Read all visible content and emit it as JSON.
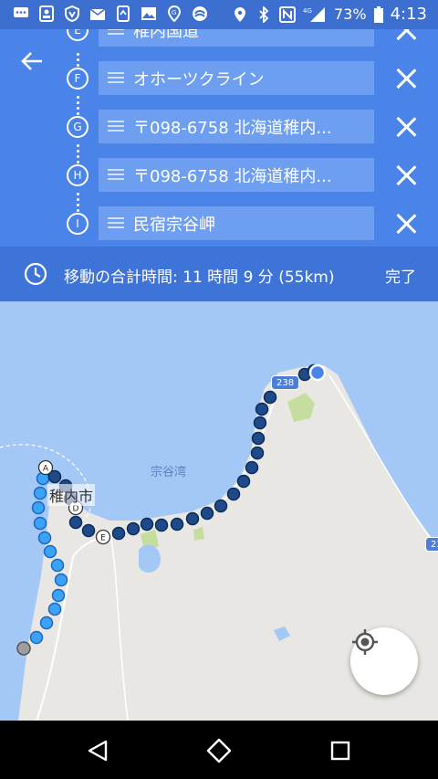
{
  "status_bar": {
    "network": "4G",
    "battery": "73%",
    "time": "4:13"
  },
  "header": {
    "back_icon": "arrow-back-icon",
    "stops": [
      {
        "letter": "E",
        "label": "稚内国道"
      },
      {
        "letter": "F",
        "label": "オホーツクライン"
      },
      {
        "letter": "G",
        "label": "〒098-6758 北海道稚内..."
      },
      {
        "letter": "H",
        "label": "〒098-6758 北海道稚内..."
      },
      {
        "letter": "I",
        "label": "民宿宗谷岬"
      }
    ]
  },
  "total": {
    "text": "移動の合計時間: 11 時間 9 分  (55km)",
    "done_label": "完了"
  },
  "map": {
    "city": "稚内市",
    "bay": "宗谷湾",
    "road_238": "238",
    "road_edge": "23",
    "markers": {
      "A": "A",
      "D": "D",
      "E": "E"
    },
    "locate_icon": "my-location-icon"
  },
  "colors": {
    "header": "#4a84e9",
    "total_bar": "#3e73d8",
    "route_dot": "#1e4a8a",
    "route_light": "#3aa3f5"
  }
}
